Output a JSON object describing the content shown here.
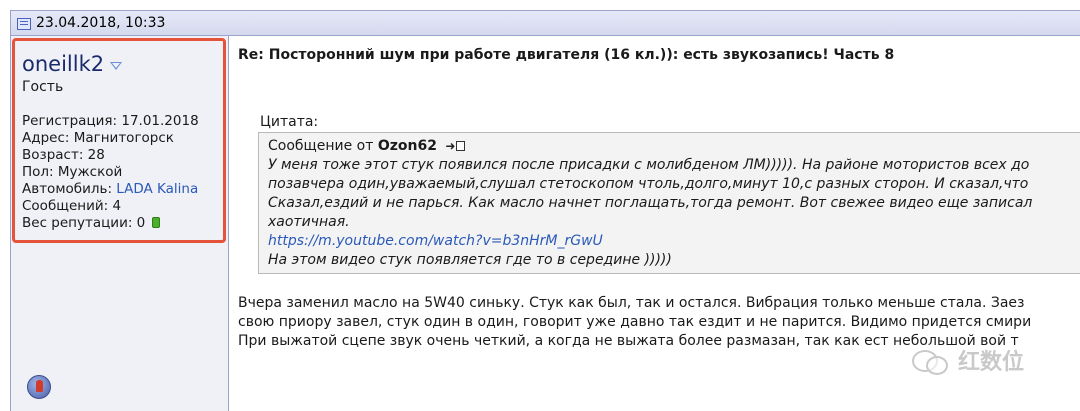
{
  "post": {
    "date": "23.04.2018, 10:33",
    "title": "Re: Посторонний шум при работе двигателя (16 кл.)): есть звукозапись! Часть 8"
  },
  "user": {
    "name": "oneillk2",
    "title": "Гость",
    "stats": {
      "registration": "Регистрация: 17.01.2018",
      "address": "Адрес: Магнитогорск",
      "age": "Возраст: 28",
      "gender": "Пол: Мужской",
      "car_label": "Автомобиль: ",
      "car_value": "LADA Kalina",
      "messages": "Сообщений: 4",
      "reputation": "Вес репутации: 0"
    }
  },
  "quote": {
    "label": "Цитата:",
    "from_prefix": "Сообщение от ",
    "author": "Ozon62",
    "lines": [
      "У меня тоже этот стук появился после присадки с молибденом ЛМ))))). На районе мотористов всех до",
      "позавчера один,уважаемый,слушал стетоскопом чтоль,долго,минут 10,с разных сторон. И сказал,что",
      "Сказал,ездий и не парься. Как масло начнет поглащать,тогда ремонт. Вот свежее видео еще записал",
      "хаотичная."
    ],
    "link": "https://m.youtube.com/watch?v=b3nHrM_rGwU",
    "last_line": "На этом видео стук появляется где то в середине )))))"
  },
  "body": {
    "lines": [
      "Вчера заменил масло на 5W40 синьку. Стук как был, так и остался. Вибрация только меньше стала. Заез",
      "свою приору завел, стук один в один, говорит уже давно так ездит и не парится. Видимо придется смири",
      "При выжатой сцепе звук очень четкий, а когда не выжата более размазан, так как ест  небольшой вой т"
    ]
  },
  "watermark": {
    "text": "红数位"
  },
  "colors": {
    "highlight_border": "#e5543a",
    "link": "#2a59b8",
    "username": "#1a2b6b",
    "reputation": "#4caf2a"
  }
}
